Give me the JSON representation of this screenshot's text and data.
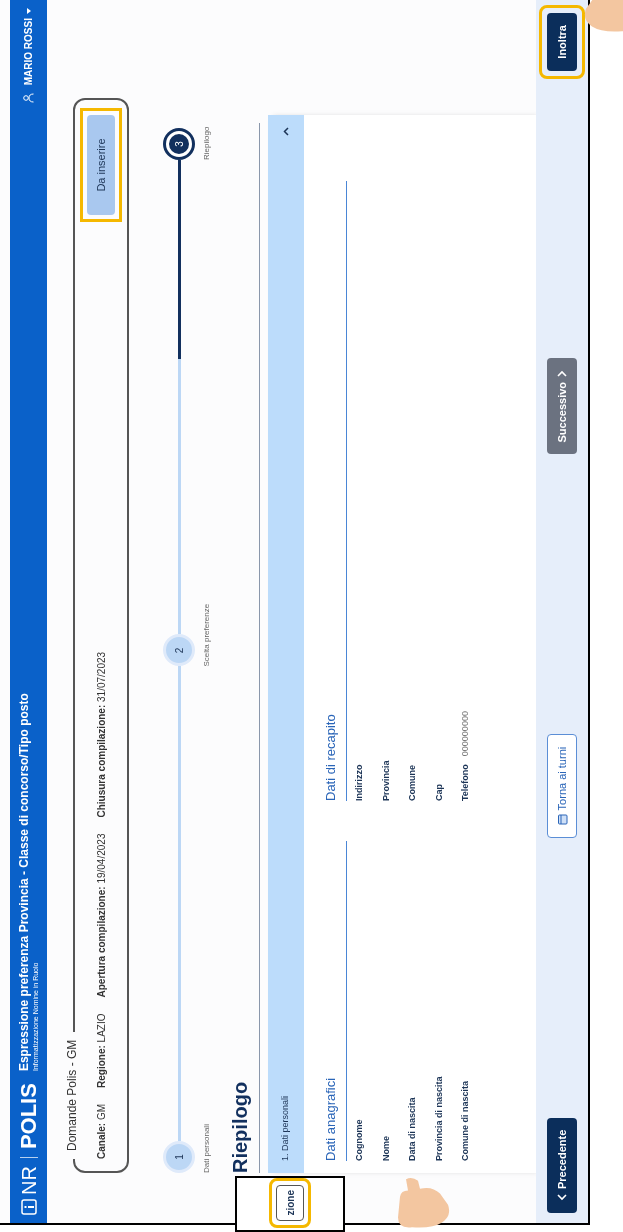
{
  "header": {
    "logo_left": "NR",
    "logo_right": "POLIS",
    "title": "Espressione preferenza Provincia - Classe di concorso/Tipo posto",
    "subtitle": "Informatizzazione Nomine in Ruolo",
    "user": "MARIO ROSSI"
  },
  "summary": {
    "legend": "Domande Polis - GM",
    "fields": [
      {
        "label": "Canale:",
        "value": "GM"
      },
      {
        "label": "Regione:",
        "value": "LAZIO"
      },
      {
        "label": "Apertura compilazione:",
        "value": "19/04/2023"
      },
      {
        "label": "Chiusura compilazione:",
        "value": "31/07/2023"
      }
    ],
    "status": {
      "label": "Da inserire",
      "highlighted": true
    }
  },
  "stepper": {
    "level": 0.58,
    "steps": [
      {
        "number": "1",
        "label": "Dati personali",
        "current": false
      },
      {
        "number": "2",
        "label": "Scelta preferenze",
        "current": false
      },
      {
        "number": "3",
        "label": "Riepilogo",
        "current": true
      }
    ]
  },
  "heading": "Riepilogo",
  "accordion": {
    "title": "1. Dati personali",
    "expanded": true,
    "sections": [
      {
        "title": "Dati anagrafici",
        "rows": [
          {
            "label": "Cognome"
          },
          {
            "label": "Nome"
          },
          {
            "label": "Data di nascita"
          },
          {
            "label": "Provincia di nascita"
          },
          {
            "label": "Comune di nascita"
          }
        ]
      },
      {
        "title": "Dati di recapito",
        "rows": [
          {
            "label": "Indirizzo"
          },
          {
            "label": "Provincia"
          },
          {
            "label": "Comune"
          },
          {
            "label": "Cap"
          },
          {
            "label": "Telefono",
            "value": "000000000"
          }
        ]
      }
    ]
  },
  "footer": {
    "buttons": [
      {
        "label": "Precedente",
        "kind": "back",
        "highlighted": false
      },
      {
        "label": "Torna ai turni",
        "kind": "outline",
        "highlighted": false
      },
      {
        "label": "Successivo",
        "kind": "next",
        "highlighted": false
      },
      {
        "label": "Inoltra",
        "kind": "primary",
        "highlighted": true
      }
    ]
  },
  "side_tab": {
    "label": "zione",
    "highlighted": true
  }
}
